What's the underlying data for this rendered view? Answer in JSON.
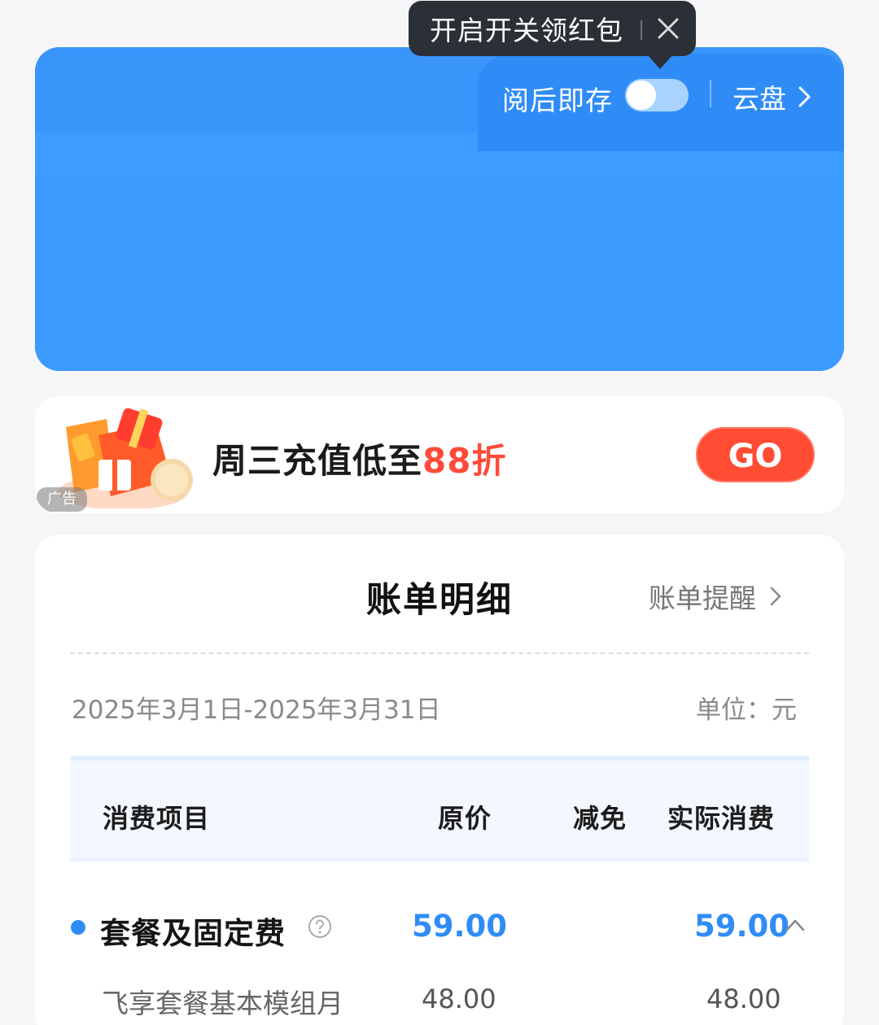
{
  "header": {
    "auto_save_label": "阅后即存",
    "auto_save_enabled": false,
    "cloud_label": "云盘",
    "colors": {
      "card": "#3d9cff",
      "toggle_track": "#a9d3ff"
    }
  },
  "tooltip": {
    "text": "开启开关领红包",
    "close_icon": "close-icon"
  },
  "ad": {
    "badge": "广告",
    "title_prefix": "周三充值低至",
    "title_highlight": "88折",
    "go_label": "GO",
    "colors": {
      "highlight": "#ff4b3a",
      "go_button": "#ff4c33"
    }
  },
  "bill": {
    "title": "账单明细",
    "reminder_label": "账单提醒",
    "period": "2025年3月1日-2025年3月31日",
    "unit": "单位：元",
    "columns": {
      "item": "消费项目",
      "original": "原价",
      "discount": "减免",
      "actual": "实际消费"
    },
    "rows": [
      {
        "name": "套餐及固定费",
        "original": "59.00",
        "discount": "",
        "actual": "59.00",
        "expanded": true
      },
      {
        "name": "飞享套餐基本模组月",
        "original": "48.00",
        "discount": "",
        "actual": "48.00"
      }
    ],
    "colors": {
      "accent": "#2f8cf7"
    }
  }
}
